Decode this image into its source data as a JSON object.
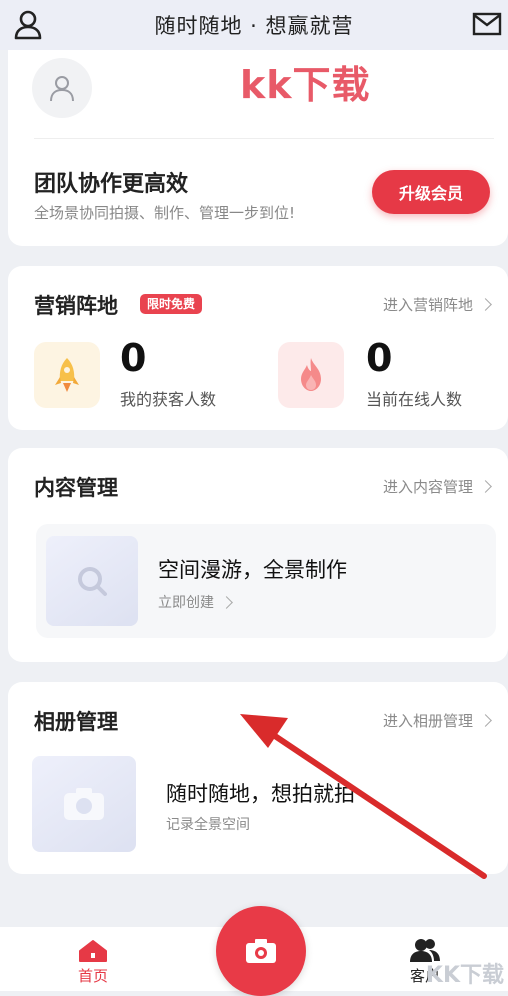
{
  "header": {
    "title": "随时随地 · 想赢就营"
  },
  "profile": {
    "watermark": "kk下载"
  },
  "team": {
    "title": "团队协作更高效",
    "subtitle": "全场景协同拍摄、制作、管理一步到位!",
    "upgrade_label": "升级会员"
  },
  "marketing": {
    "title": "营销阵地",
    "badge": "限时免费",
    "link": "进入营销阵地",
    "stats": [
      {
        "value": "0",
        "label": "我的获客人数",
        "icon": "rocket-icon"
      },
      {
        "value": "0",
        "label": "当前在线人数",
        "icon": "flame-icon"
      }
    ]
  },
  "content": {
    "title": "内容管理",
    "link": "进入内容管理",
    "feature_title": "空间漫游，全景制作",
    "feature_sub": "立即创建"
  },
  "album": {
    "title": "相册管理",
    "link": "进入相册管理",
    "feature_title": "随时随地，想拍就拍",
    "feature_sub": "记录全景空间"
  },
  "nav": {
    "home": "首页",
    "clients": "客户"
  },
  "overlay": {
    "corner_logo": "KK下载"
  },
  "colors": {
    "accent": "#e63946",
    "background": "#eef0f4",
    "arrow": "#d92b2b"
  }
}
